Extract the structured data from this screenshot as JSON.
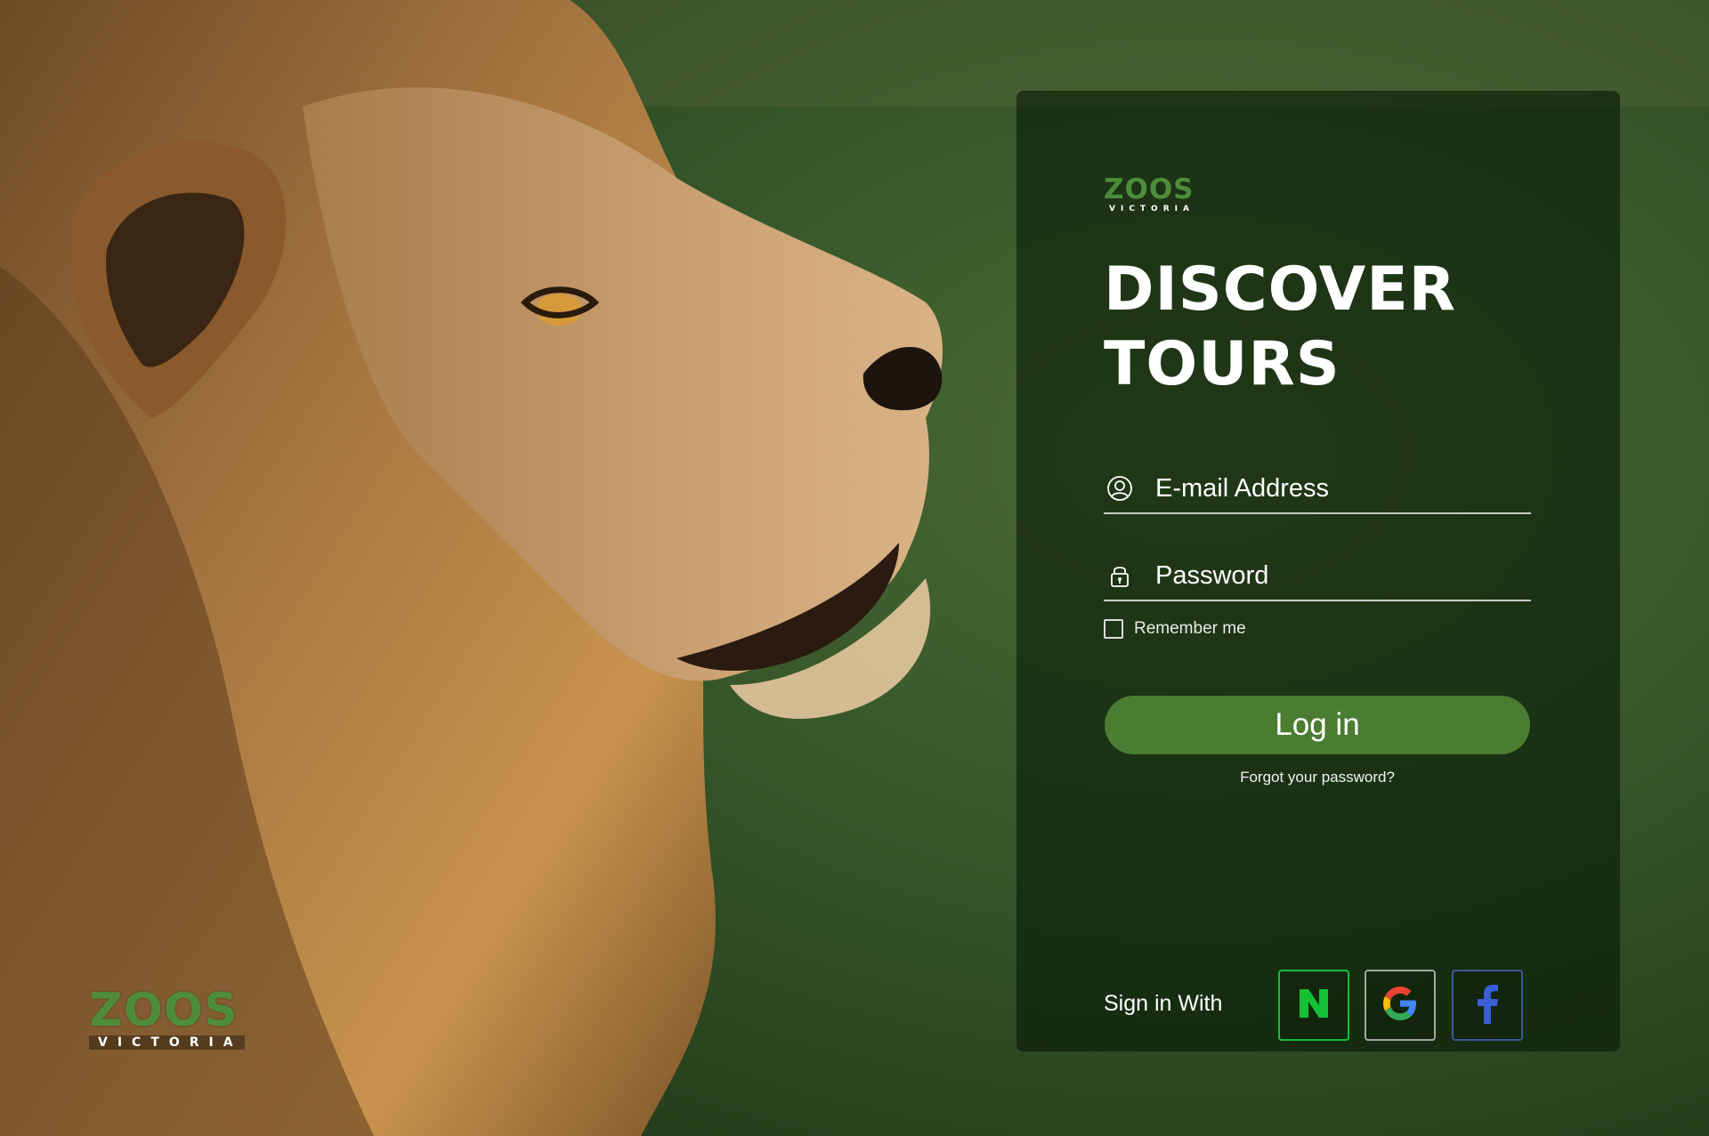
{
  "brand": {
    "logo_main": "ZOOS",
    "logo_sub": "VICTORIA"
  },
  "hero": {
    "line1": "DISCOVER",
    "line2": "TOURS"
  },
  "form": {
    "email_placeholder": "E-mail Address",
    "password_placeholder": "Password",
    "remember_label": "Remember me",
    "login_label": "Log in",
    "forgot_label": "Forgot your password?"
  },
  "social": {
    "label": "Sign in With",
    "providers": [
      {
        "name": "N",
        "icon": "naver-icon",
        "color": "#14c135"
      },
      {
        "name": "G",
        "icon": "google-icon",
        "color": "#4285f4"
      },
      {
        "name": "f",
        "icon": "facebook-icon",
        "color": "#3b5998"
      }
    ]
  },
  "colors": {
    "accent": "#4a7c32",
    "logo_green": "#4f8c3a"
  }
}
